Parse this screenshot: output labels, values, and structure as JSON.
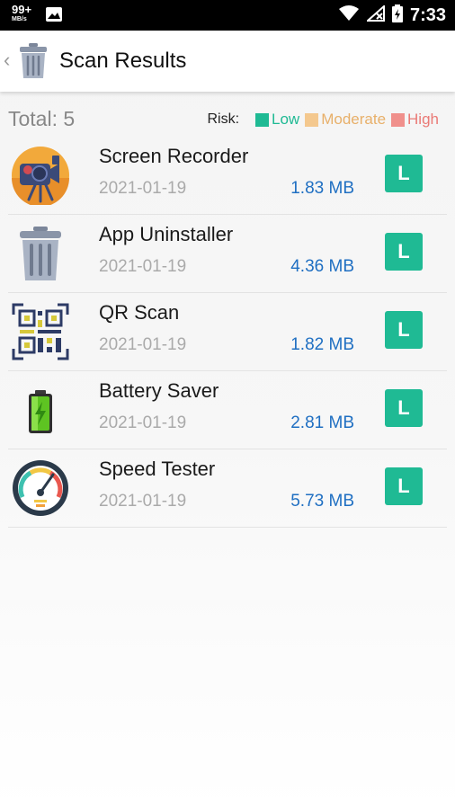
{
  "status_bar": {
    "network_speed": "99+",
    "network_unit": "MB/s",
    "time": "7:33"
  },
  "header": {
    "title": "Scan Results"
  },
  "summary": {
    "total_label": "Total: 5",
    "risk_label": "Risk:",
    "legend": [
      {
        "label": "Low",
        "color": "#1fba94"
      },
      {
        "label": "Moderate",
        "color": "#f4c88e"
      },
      {
        "label": "High",
        "color": "#f0908c"
      }
    ]
  },
  "apps": [
    {
      "name": "Screen Recorder",
      "date": "2021-01-19",
      "size": "1.83 MB",
      "risk": "L",
      "icon": "video-camera-icon"
    },
    {
      "name": "App Uninstaller",
      "date": "2021-01-19",
      "size": "4.36 MB",
      "risk": "L",
      "icon": "trash-can-icon"
    },
    {
      "name": "QR Scan",
      "date": "2021-01-19",
      "size": "1.82 MB",
      "risk": "L",
      "icon": "qr-code-icon"
    },
    {
      "name": "Battery Saver",
      "date": "2021-01-19",
      "size": "2.81 MB",
      "risk": "L",
      "icon": "battery-icon"
    },
    {
      "name": "Speed Tester",
      "date": "2021-01-19",
      "size": "5.73 MB",
      "risk": "L",
      "icon": "speedometer-icon"
    }
  ],
  "colors": {
    "risk_low": "#1fba94",
    "size_text": "#1f6fc2"
  }
}
